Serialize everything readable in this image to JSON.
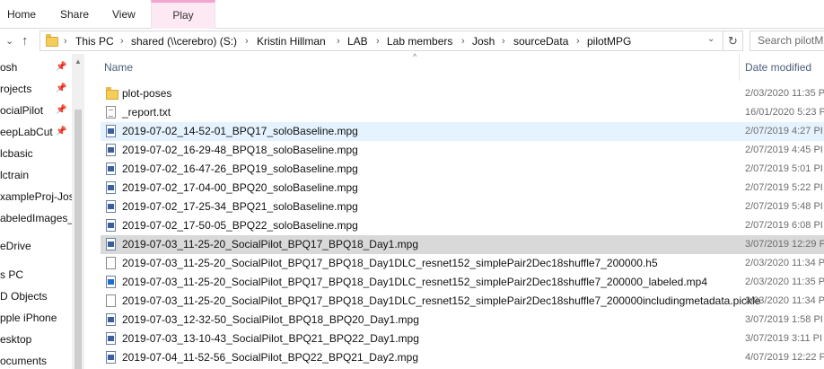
{
  "ribbon": {
    "tabs": [
      "Home",
      "Share",
      "View",
      "Play"
    ],
    "active_tab": "Play"
  },
  "address": {
    "breadcrumbs": [
      "This PC",
      "shared (\\\\cerebro) (S:)",
      "Kristin Hillman",
      "LAB",
      "Lab members",
      "Josh",
      "sourceData",
      "pilotMPG"
    ],
    "search_placeholder": "Search pilotMPG"
  },
  "nav": {
    "items": [
      {
        "label": "osh",
        "pinned": true
      },
      {
        "label": "rojects",
        "pinned": true
      },
      {
        "label": "ocialPilot",
        "pinned": true
      },
      {
        "label": "eepLabCut",
        "pinned": true
      },
      {
        "label": "lcbasic",
        "pinned": false
      },
      {
        "label": "lctrain",
        "pinned": false
      },
      {
        "label": "xampleProj-Jos",
        "pinned": false
      },
      {
        "label": "abeledImages_l",
        "pinned": false
      },
      {
        "label": "eDrive",
        "pinned": false
      },
      {
        "label": "s PC",
        "pinned": false
      },
      {
        "label": "D Objects",
        "pinned": false
      },
      {
        "label": "pple iPhone",
        "pinned": false
      },
      {
        "label": "esktop",
        "pinned": false
      },
      {
        "label": "ocuments",
        "pinned": false
      }
    ]
  },
  "columns": {
    "name": "Name",
    "date_modified": "Date modified"
  },
  "files": [
    {
      "name": "plot-poses",
      "date": "2/03/2020 11:35 P",
      "icon": "folder-icon"
    },
    {
      "name": "_report.txt",
      "date": "16/01/2020 5:23 P",
      "icon": "text-file-icon"
    },
    {
      "name": "2019-07-02_14-52-01_BPQ17_soloBaseline.mpg",
      "date": "2/07/2019 4:27 PI",
      "icon": "video-file-icon"
    },
    {
      "name": "2019-07-02_16-29-48_BPQ18_soloBaseline.mpg",
      "date": "2/07/2019 4:45 PI",
      "icon": "video-file-icon"
    },
    {
      "name": "2019-07-02_16-47-26_BPQ19_soloBaseline.mpg",
      "date": "2/07/2019 5:01 PI",
      "icon": "video-file-icon"
    },
    {
      "name": "2019-07-02_17-04-00_BPQ20_soloBaseline.mpg",
      "date": "2/07/2019 5:22 PI",
      "icon": "video-file-icon"
    },
    {
      "name": "2019-07-02_17-25-34_BPQ21_soloBaseline.mpg",
      "date": "2/07/2019 5:48 PI",
      "icon": "video-file-icon"
    },
    {
      "name": "2019-07-02_17-50-05_BPQ22_soloBaseline.mpg",
      "date": "2/07/2019 6:08 PI",
      "icon": "video-file-icon"
    },
    {
      "name": "2019-07-03_11-25-20_SocialPilot_BPQ17_BPQ18_Day1.mpg",
      "date": "3/07/2019 12:29 F",
      "icon": "video-file-icon"
    },
    {
      "name": "2019-07-03_11-25-20_SocialPilot_BPQ17_BPQ18_Day1DLC_resnet152_simplePair2Dec18shuffle7_200000.h5",
      "date": "2/03/2020 11:34 P",
      "icon": "blank-file-icon"
    },
    {
      "name": "2019-07-03_11-25-20_SocialPilot_BPQ17_BPQ18_Day1DLC_resnet152_simplePair2Dec18shuffle7_200000_labeled.mp4",
      "date": "2/03/2020 11:35 P",
      "icon": "mp4-file-icon"
    },
    {
      "name": "2019-07-03_11-25-20_SocialPilot_BPQ17_BPQ18_Day1DLC_resnet152_simplePair2Dec18shuffle7_200000includingmetadata.pickle",
      "date": "2/03/2020 11:34 P",
      "icon": "blank-file-icon"
    },
    {
      "name": "2019-07-03_12-32-50_SocialPilot_BPQ18_BPQ20_Day1.mpg",
      "date": "3/07/2019 1:58 PI",
      "icon": "video-file-icon"
    },
    {
      "name": "2019-07-03_13-10-43_SocialPilot_BPQ21_BPQ22_Day1.mpg",
      "date": "3/07/2019 3:11 PI",
      "icon": "video-file-icon"
    },
    {
      "name": "2019-07-04_11-52-56_SocialPilot_BPQ22_BPQ21_Day2.mpg",
      "date": "4/07/2019 12:22 F",
      "icon": "video-file-icon"
    }
  ]
}
